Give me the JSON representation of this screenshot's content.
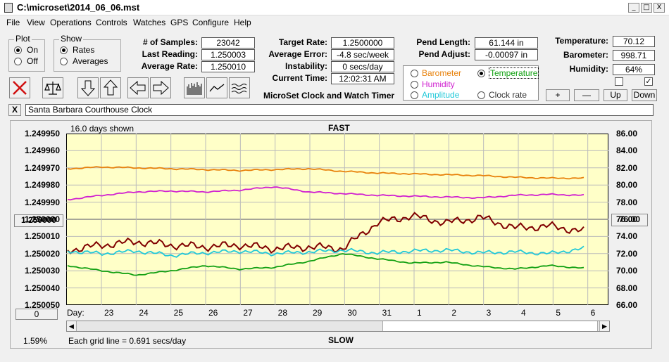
{
  "window": {
    "title": "C:\\microset\\2014_06_06.mst",
    "min": "_",
    "max": "□",
    "close": "X"
  },
  "menu": [
    "File",
    "View",
    "Operations",
    "Controls",
    "Watches",
    "GPS",
    "Configure",
    "Help"
  ],
  "plot_group": {
    "title": "Plot",
    "on": "On",
    "off": "Off"
  },
  "show_group": {
    "title": "Show",
    "rates": "Rates",
    "averages": "Averages"
  },
  "stats": {
    "samples_label": "# of Samples:",
    "samples": "23042",
    "last_label": "Last Reading:",
    "last": "1.250003",
    "avg_label": "Average Rate:",
    "avg": "1.250010"
  },
  "rates": {
    "target_label": "Target Rate:",
    "target": "1.2500000",
    "error_label": "Average Error:",
    "error": "-4.8 sec/week",
    "instab_label": "Instability:",
    "instab": "0 secs/day",
    "time_label": "Current Time:",
    "time": "12:02:31 AM"
  },
  "app_name": "MicroSet Clock and Watch Timer",
  "pend": {
    "length_label": "Pend Length:",
    "length": "61.144 in",
    "adjust_label": "Pend Adjust:",
    "adjust": "-0.00097 in"
  },
  "env": {
    "temp_label": "Temperature:",
    "temp": "70.12",
    "baro_label": "Barometer:",
    "baro": "998.71",
    "hum_label": "Humidity:",
    "hum": "64%"
  },
  "legend": {
    "barometer": "Barometer",
    "temperature": "Temperature",
    "humidity": "Humidity",
    "amplitude": "Amplitude",
    "clockrate": "Clock rate",
    "colors": {
      "barometer": "#e8820c",
      "temperature": "#12a012",
      "humidity": "#d020d0",
      "amplitude": "#20c8d8",
      "clockrate": "#800000"
    }
  },
  "adj_buttons": {
    "plus": "+",
    "minus": "—",
    "up": "Up",
    "down": "Down"
  },
  "clock_name": "Santa Barbara Courthouse Clock",
  "close_x": "X",
  "plot": {
    "days_shown": "16.0 days shown",
    "fast": "FAST",
    "slow": "SLOW",
    "grid_note": "Each grid line = 0.691 secs/day",
    "left_button": "1.250000",
    "right_button": "76.00",
    "zero_button": "0",
    "percent": "1.59%",
    "day_label": "Day:"
  },
  "chart_data": {
    "type": "line",
    "left_ticks": [
      "1.249950",
      "1.249960",
      "1.249970",
      "1.249980",
      "1.249990",
      "1.250000",
      "1.250010",
      "1.250020",
      "1.250030",
      "1.250040",
      "1.250050"
    ],
    "right_ticks": [
      "86.00",
      "84.00",
      "82.00",
      "80.00",
      "78.00",
      "76.00",
      "74.00",
      "72.00",
      "70.00",
      "68.00",
      "66.00"
    ],
    "x_labels": [
      "23",
      "24",
      "25",
      "26",
      "27",
      "28",
      "29",
      "30",
      "31",
      "1",
      "2",
      "3",
      "4",
      "5",
      "6"
    ],
    "y_left_range": [
      1.24995,
      1.25005
    ],
    "y_right_range": [
      66,
      86
    ],
    "series": [
      {
        "key": "barometer",
        "color": "#e8820c",
        "axis": "right",
        "values": [
          81.9,
          82.1,
          82.0,
          81.9,
          81.8,
          81.7,
          81.8,
          81.9,
          81.6,
          81.4,
          81.3,
          81.2,
          81.1,
          80.9,
          80.8,
          80.8
        ]
      },
      {
        "key": "humidity",
        "color": "#d020d0",
        "axis": "right",
        "values": [
          78.3,
          78.8,
          79.2,
          79.3,
          79.2,
          79.4,
          79.8,
          79.2,
          79.0,
          78.8,
          78.7,
          78.6,
          78.5,
          78.8,
          78.9,
          78.8
        ]
      },
      {
        "key": "clockrate",
        "color": "#800000",
        "axis": "left",
        "values": [
          1.250018,
          1.250015,
          1.250013,
          1.250015,
          1.250016,
          1.250015,
          1.250017,
          1.250016,
          1.250017,
          1.250002,
          1.249998,
          1.250002,
          1.249999,
          1.250005,
          1.250004,
          1.250007
        ]
      },
      {
        "key": "amplitude",
        "color": "#20c8d8",
        "axis": "right",
        "values": [
          72.3,
          72.0,
          72.3,
          71.8,
          72.1,
          72.3,
          72.0,
          72.2,
          72.4,
          72.1,
          72.3,
          72.4,
          72.1,
          72.2,
          72.0,
          72.6
        ]
      },
      {
        "key": "temperature",
        "color": "#12a012",
        "axis": "right",
        "values": [
          70.6,
          70.0,
          69.5,
          70.0,
          70.6,
          70.2,
          70.4,
          71.1,
          72.0,
          71.4,
          70.9,
          71.0,
          70.5,
          70.2,
          70.6,
          70.3
        ]
      }
    ]
  }
}
